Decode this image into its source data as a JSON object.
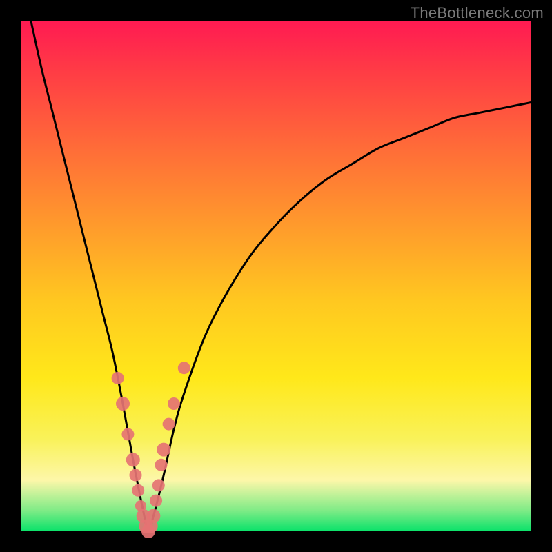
{
  "watermark": "TheBottleneck.com",
  "colors": {
    "frame": "#000000",
    "curve": "#000000",
    "dot": "#e57373",
    "watermark": "#7a7a7a"
  },
  "chart_data": {
    "type": "line",
    "title": "",
    "xlabel": "",
    "ylabel": "",
    "xrange": [
      0,
      100
    ],
    "yrange": [
      0,
      100
    ],
    "grid": false,
    "legend": false,
    "description": "V-shaped bottleneck curve on a red-to-green vertical gradient background. y is bottleneck percentage (0 at bottom = good/green, 100 at top = bad/red). The minimum (y≈0) occurs around x≈25.",
    "series": [
      {
        "name": "bottleneck-curve",
        "x": [
          2,
          4,
          6,
          8,
          10,
          12,
          14,
          16,
          18,
          20,
          22,
          24,
          25,
          26,
          28,
          30,
          32,
          36,
          40,
          45,
          50,
          55,
          60,
          65,
          70,
          75,
          80,
          85,
          90,
          95,
          100
        ],
        "y": [
          100,
          91,
          83,
          75,
          67,
          59,
          51,
          43,
          35,
          25,
          14,
          4,
          0,
          3,
          11,
          20,
          27,
          38,
          46,
          54,
          60,
          65,
          69,
          72,
          75,
          77,
          79,
          81,
          82,
          83,
          84
        ]
      }
    ],
    "markers": {
      "name": "highlighted-samples",
      "x": [
        19,
        20,
        21,
        22,
        22.5,
        23,
        23.5,
        24,
        24.5,
        25,
        25.5,
        26,
        26.5,
        27,
        27.5,
        28,
        29,
        30,
        32
      ],
      "y": [
        30,
        25,
        19,
        14,
        11,
        8,
        5,
        3,
        1,
        0,
        1,
        3,
        6,
        9,
        13,
        16,
        21,
        25,
        32
      ],
      "r": [
        9,
        10,
        9,
        10,
        9,
        9,
        8,
        10,
        10,
        10,
        10,
        10,
        9,
        9,
        9,
        10,
        9,
        9,
        9
      ]
    }
  }
}
